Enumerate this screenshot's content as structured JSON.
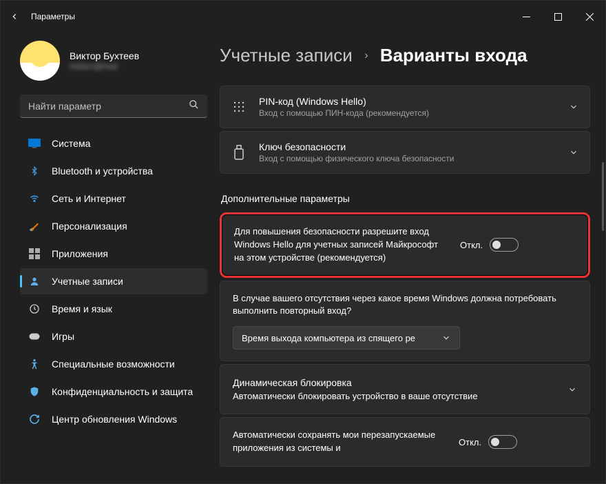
{
  "appTitle": "Параметры",
  "profile": {
    "name": "Виктор Бухтеев",
    "email": "hidden@mail"
  },
  "search": {
    "placeholder": "Найти параметр"
  },
  "nav": [
    {
      "key": "system",
      "label": "Система"
    },
    {
      "key": "bluetooth",
      "label": "Bluetooth и устройства"
    },
    {
      "key": "network",
      "label": "Сеть и Интернет"
    },
    {
      "key": "personalization",
      "label": "Персонализация"
    },
    {
      "key": "apps",
      "label": "Приложения"
    },
    {
      "key": "accounts",
      "label": "Учетные записи",
      "active": true
    },
    {
      "key": "time",
      "label": "Время и язык"
    },
    {
      "key": "gaming",
      "label": "Игры"
    },
    {
      "key": "accessibility",
      "label": "Специальные возможности"
    },
    {
      "key": "privacy",
      "label": "Конфиденциальность и защита"
    },
    {
      "key": "update",
      "label": "Центр обновления Windows"
    }
  ],
  "breadcrumb": {
    "parent": "Учетные записи",
    "current": "Варианты входа"
  },
  "cards": {
    "pin": {
      "title": "PIN-код (Windows Hello)",
      "sub": "Вход с помощью ПИН-кода (рекомендуется)"
    },
    "key": {
      "title": "Ключ безопасности",
      "sub": "Вход с помощью физического ключа безопасности"
    }
  },
  "additionalTitle": "Дополнительные параметры",
  "helloSetting": {
    "text": "Для повышения безопасности разрешите вход Windows Hello для учетных записей Майкрософт на этом устройстве (рекомендуется)",
    "state": "Откл."
  },
  "absence": {
    "text": "В случае вашего отсутствия через какое время Windows должна потребовать выполнить повторный вход?",
    "selected": "Время выхода компьютера из спящего ре"
  },
  "dynamicLock": {
    "title": "Динамическая блокировка",
    "sub": "Автоматически блокировать устройство в ваше отсутствие"
  },
  "appsRestart": {
    "text": "Автоматически сохранять мои перезапускаемые приложения из системы и",
    "state": "Откл."
  }
}
